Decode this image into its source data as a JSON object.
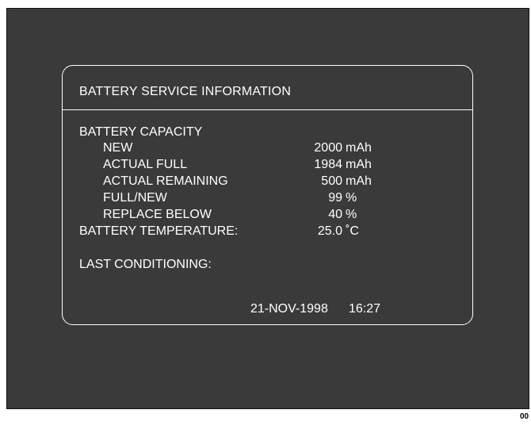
{
  "panel": {
    "title": "BATTERY SERVICE INFORMATION",
    "section_capacity": "BATTERY CAPACITY",
    "rows": [
      {
        "label": "NEW",
        "value": "2000",
        "unit": "mAh"
      },
      {
        "label": "ACTUAL FULL",
        "value": "1984",
        "unit": "mAh"
      },
      {
        "label": "ACTUAL REMAINING",
        "value": "500",
        "unit": "mAh"
      },
      {
        "label": "FULL/NEW",
        "value": "99",
        "unit": "%"
      },
      {
        "label": "REPLACE BELOW",
        "value": "40",
        "unit": "%"
      }
    ],
    "temperature": {
      "label": "BATTERY TEMPERATURE:",
      "value": "25.0",
      "unit": "˚C"
    },
    "last_conditioning_label": "LAST CONDITIONING:",
    "footer_date": "21-NOV-1998",
    "footer_time": "16:27"
  },
  "figure_code": "00",
  "colors": {
    "screen_background": "#3a3a3a",
    "text": "#ffffff",
    "page_background": "#ffffff"
  }
}
